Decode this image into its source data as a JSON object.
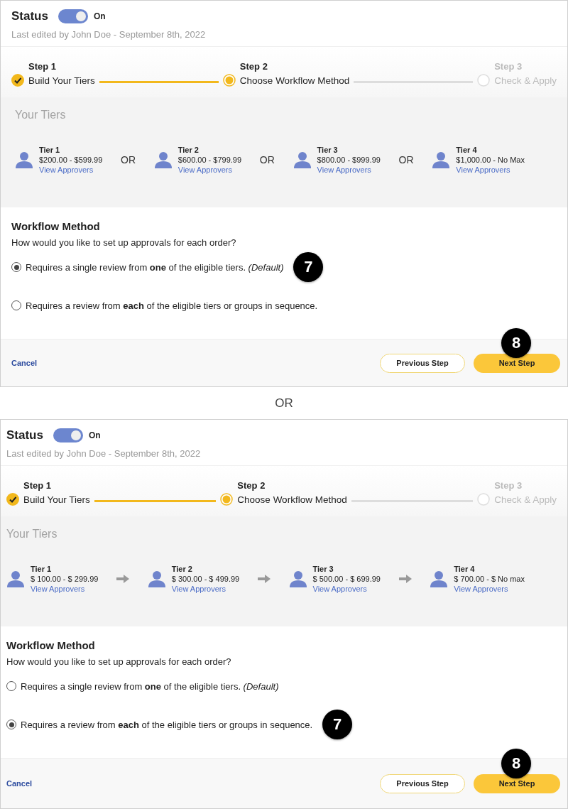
{
  "panels": [
    {
      "status": {
        "label": "Status",
        "toggle_on": true,
        "toggle_text": "On",
        "last_edited": "Last edited by John Doe - September 8th, 2022"
      },
      "steps": [
        {
          "label": "Step 1",
          "title": "Build Your Tiers",
          "completed": true,
          "current": false
        },
        {
          "label": "Step 2",
          "title": "Choose Workflow Method",
          "completed": false,
          "current": true
        },
        {
          "label": "Step 3",
          "title": "Check & Apply",
          "completed": false,
          "current": false
        }
      ],
      "tiers_title": "Your Tiers",
      "tiers": [
        {
          "name": "Tier 1",
          "range": "$200.00 - $599.99",
          "link": "View Approvers"
        },
        {
          "name": "Tier 2",
          "range": "$600.00 - $799.99",
          "link": "View Approvers"
        },
        {
          "name": "Tier 3",
          "range": "$800.00 - $999.99",
          "link": "View Approvers"
        },
        {
          "name": "Tier 4",
          "range": "$1,000.00 - No Max",
          "link": "View Approvers"
        }
      ],
      "separators": [
        {
          "kind": "text",
          "text": "OR"
        },
        {
          "kind": "text",
          "text": "OR"
        },
        {
          "kind": "text",
          "text": "OR"
        }
      ],
      "workflow": {
        "title": "Workflow Method",
        "question": "How would you like to set up approvals for each order?",
        "options": [
          {
            "text": "Requires a single review from **one** of the eligible tiers. *(Default)*",
            "selected": true,
            "badge": "7"
          },
          {
            "text": "Requires a review from **each** of the eligible tiers or groups in sequence.",
            "selected": false
          }
        ]
      },
      "footer": {
        "cancel": "Cancel",
        "previous": "Previous Step",
        "next": "Next Step",
        "next_badge": "8"
      }
    },
    {
      "status": {
        "label": "Status",
        "toggle_on": true,
        "toggle_text": "On",
        "last_edited": "Last edited by John Doe - September 8th, 2022"
      },
      "steps": [
        {
          "label": "Step 1",
          "title": "Build Your Tiers",
          "completed": true,
          "current": false
        },
        {
          "label": "Step 2",
          "title": "Choose Workflow Method",
          "completed": false,
          "current": true
        },
        {
          "label": "Step 3",
          "title": "Check & Apply",
          "completed": false,
          "current": false
        }
      ],
      "tiers_title": "Your Tiers",
      "tiers": [
        {
          "name": "Tier 1",
          "range": "$ 100.00 - $ 299.99",
          "link": "View Approvers"
        },
        {
          "name": "Tier 2",
          "range": "$ 300.00 - $ 499.99",
          "link": "View Approvers"
        },
        {
          "name": "Tier 3",
          "range": "$ 500.00 - $ 699.99",
          "link": "View Approvers"
        },
        {
          "name": "Tier 4",
          "range": "$ 700.00 - $ No max",
          "link": "View Approvers"
        }
      ],
      "separators": [
        {
          "kind": "arrow"
        },
        {
          "kind": "arrow"
        },
        {
          "kind": "arrow"
        }
      ],
      "workflow": {
        "title": "Workflow Method",
        "question": "How would you like to set up approvals for each order?",
        "options": [
          {
            "text": "Requires a single review from **one** of the eligible tiers. *(Default)*",
            "selected": false
          },
          {
            "text": "Requires a review from **each** of the eligible tiers or groups in sequence.",
            "selected": true,
            "badge": "7"
          }
        ]
      },
      "footer": {
        "cancel": "Cancel",
        "previous": "Previous Step",
        "next": "Next Step",
        "next_badge": "8"
      }
    }
  ],
  "divider": "OR"
}
